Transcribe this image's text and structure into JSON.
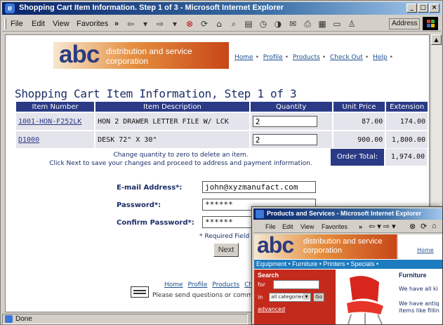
{
  "window": {
    "title": "Shopping Cart Item Information. Step 1 of 3 - Microsoft Internet Explorer",
    "address_label": "Address",
    "status": "Done"
  },
  "menu": [
    "File",
    "Edit",
    "View",
    "Favorites"
  ],
  "banner": {
    "logo": "abc",
    "tagline_1": "distribution and service",
    "tagline_2": "corporation"
  },
  "top_nav": [
    "Home",
    "Profile",
    "Products",
    "Check Out",
    "Help"
  ],
  "page_title": "Shopping Cart Item Information, Step 1 of 3",
  "table": {
    "headers": [
      "Item Number",
      "Item Description",
      "Quantity",
      "Unit Price",
      "Extension"
    ],
    "rows": [
      {
        "item_number": "1001-HON-F252LK",
        "description": "HON 2 DRAWER LETTER FILE W/ LCK",
        "quantity": "2",
        "unit_price": "87.00",
        "extension": "174.00"
      },
      {
        "item_number": "D1000",
        "description": "DESK 72\" X 30\"",
        "quantity": "2",
        "unit_price": "900.00",
        "extension": "1,800.00"
      }
    ],
    "note_1": "Change quantity to zero to delete an item.",
    "note_2": "Click Next to save your changes and proceed to address and payment information.",
    "order_total_label": "Order Total:",
    "order_total_value": "1,974.00"
  },
  "form": {
    "email_label": "E-mail Address*:",
    "email_value": "john@xyzmanufact.com",
    "password_label": "Password*:",
    "password_value": "******",
    "confirm_label": "Confirm Password*:",
    "confirm_value": "******",
    "required_note": "* Required Field",
    "next_button": "Next"
  },
  "footer": {
    "links": [
      "Home",
      "Profile",
      "Products",
      "Check"
    ],
    "note": "Please send questions or commen"
  },
  "window2": {
    "title": "Products and Services - Microsoft Internet Explorer",
    "menu": [
      "File",
      "Edit",
      "View",
      "Favorites"
    ],
    "banner_logo": "abc",
    "banner_line_1": "distribution and service",
    "banner_line_2": "corporation",
    "home_link": "Home",
    "nav": "Equipment • Furniture • Printers • Specials •",
    "search_title": "Search",
    "for_label": "for",
    "in_label": "in",
    "category_value": "all categories",
    "go_button": "Go",
    "advanced_link": "advanced",
    "section_title": "Furniture",
    "text_1": "We have all ki",
    "text_2a": "We have antiq",
    "text_2b": "items like fillin"
  },
  "colors": {
    "title_bar": "#0a246a",
    "header_navy": "#2a3a85",
    "cell_grey": "#e4e4ec",
    "accent_orange": "#e58f3f",
    "search_red": "#c42a1c",
    "nav_blue": "#1d7bbf"
  }
}
